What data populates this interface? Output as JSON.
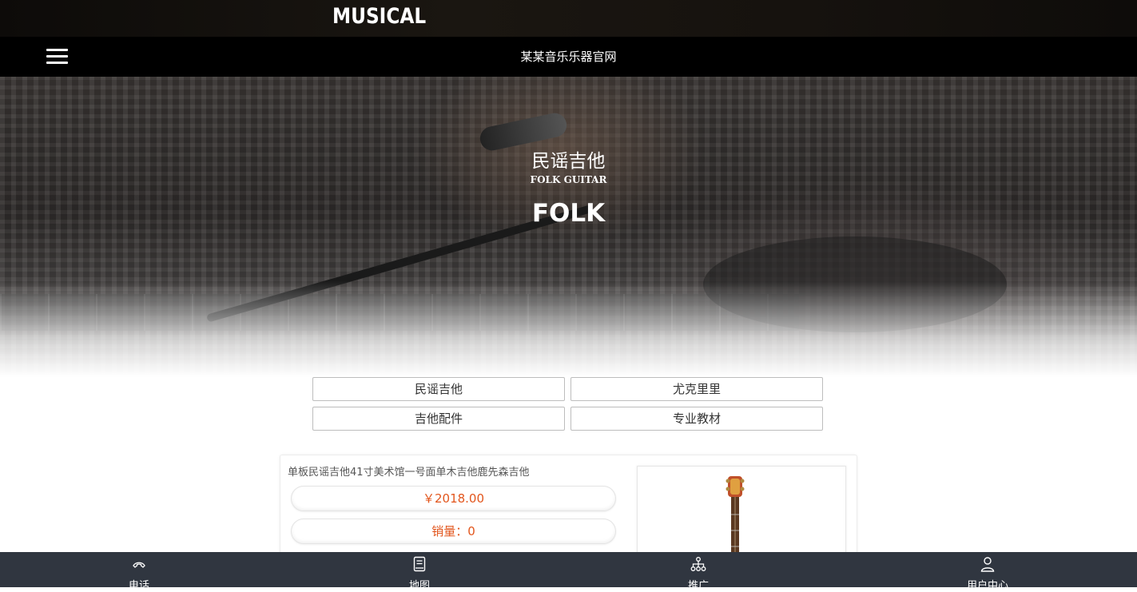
{
  "header": {
    "brand": "MUSICAL",
    "site_title": "某某音乐乐器官网",
    "menu_icon": "hamburger-menu-icon"
  },
  "hero": {
    "title_cn": "民谣吉他",
    "title_en": "FOLK GUITAR",
    "title_big": "FOLK"
  },
  "categories": [
    {
      "label": "民谣吉他"
    },
    {
      "label": "尤克里里"
    },
    {
      "label": "吉他配件"
    },
    {
      "label": "专业教材"
    }
  ],
  "product": {
    "name": "单板民谣吉他41寸美术馆一号面单木吉他鹿先森吉他",
    "price": "￥2018.00",
    "sales": "销量：0"
  },
  "bottom_nav": [
    {
      "label": "电话",
      "icon": "phone-icon"
    },
    {
      "label": "地图",
      "icon": "map-book-icon"
    },
    {
      "label": "推广",
      "icon": "network-share-icon"
    },
    {
      "label": "用户中心",
      "icon": "user-icon"
    }
  ],
  "colors": {
    "nav_bg": "#000000",
    "bottom_bar_bg": "#303640",
    "price_color": "#e2561d"
  }
}
